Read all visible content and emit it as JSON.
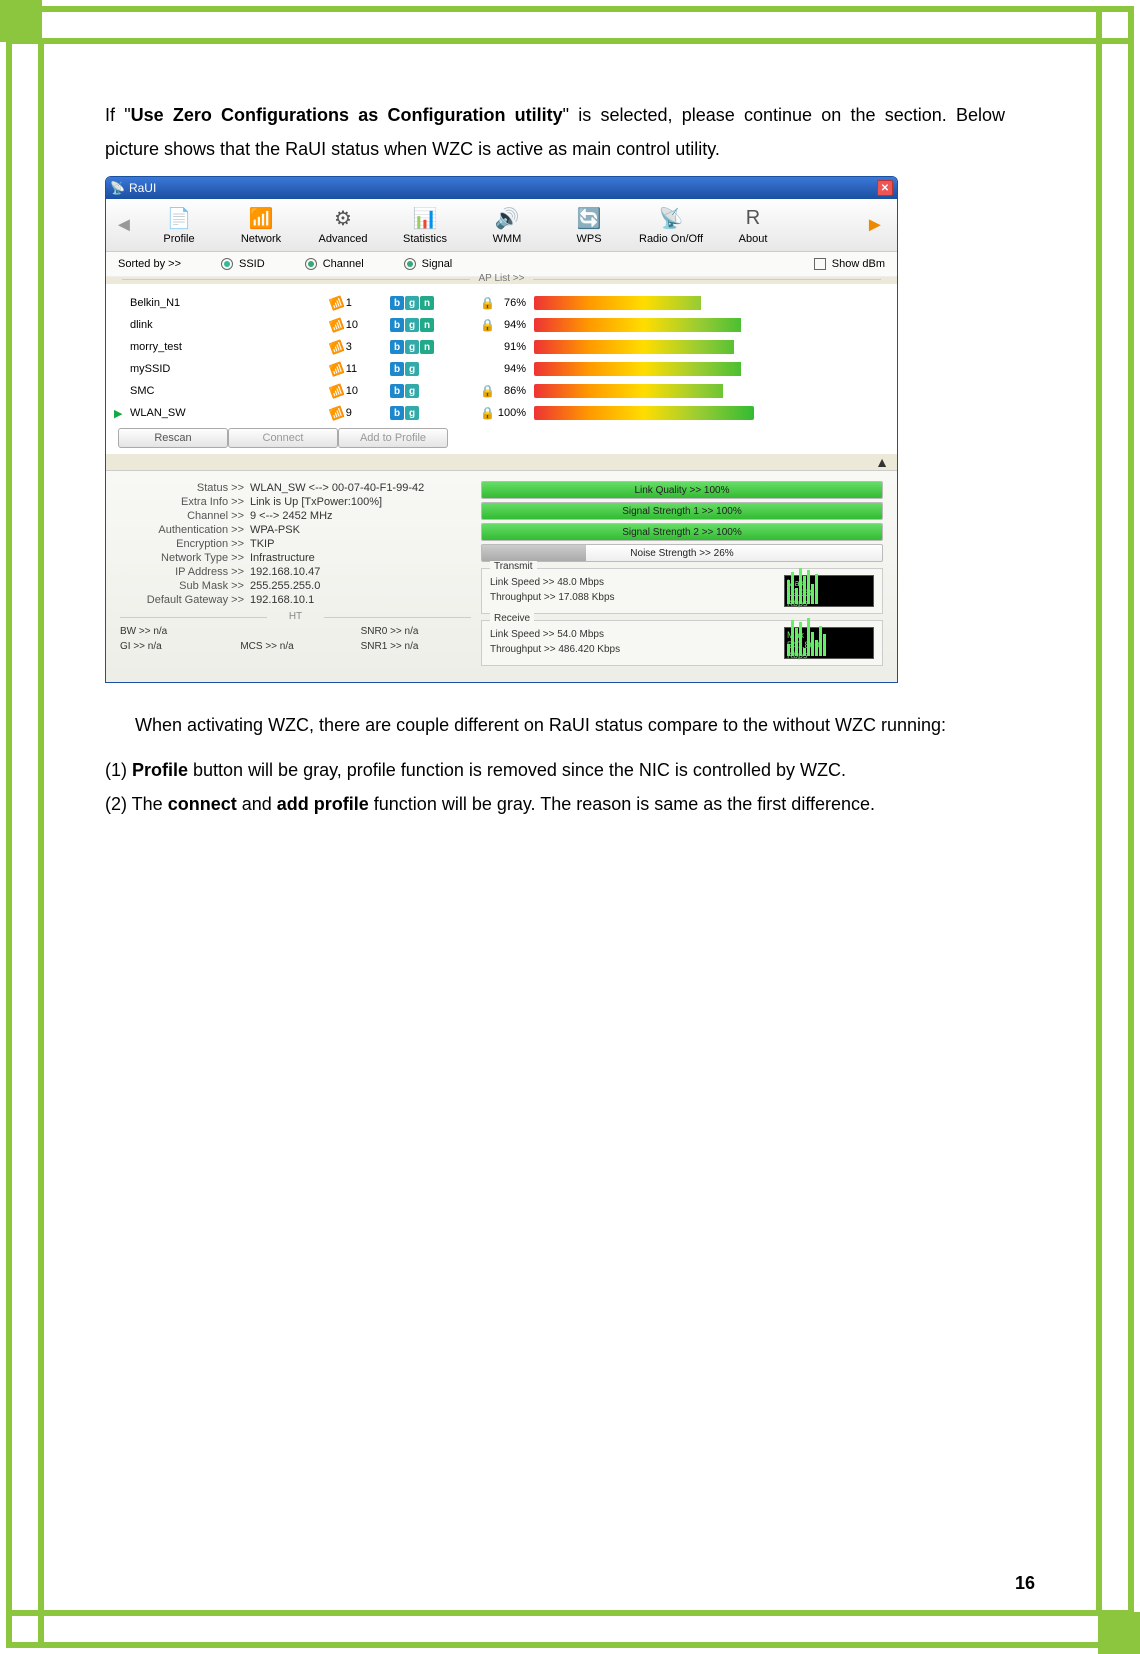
{
  "page_number": "16",
  "prose": {
    "p1a": "If \"",
    "p1b": "Use Zero Configurations as Configuration utility",
    "p1c": "\" is selected, please continue on the section. Below picture shows that the RaUI status when WZC is active as main control utility.",
    "p2": "When activating WZC, there are couple different on RaUI status compare to the without WZC running:",
    "li1a": "(1) ",
    "li1b": "Profile",
    "li1c": " button will be gray, profile function is removed since the NIC is controlled by WZC.",
    "li2a": "(2) The ",
    "li2b": "connect",
    "li2c": " and ",
    "li2d": "add profile",
    "li2e": " function will be gray. The reason is same as the first difference."
  },
  "window": {
    "title": "RaUI",
    "toolbar": {
      "items": [
        {
          "label": "Profile"
        },
        {
          "label": "Network"
        },
        {
          "label": "Advanced"
        },
        {
          "label": "Statistics"
        },
        {
          "label": "WMM"
        },
        {
          "label": "WPS"
        },
        {
          "label": "Radio On/Off"
        },
        {
          "label": "About"
        }
      ]
    },
    "sortbar": {
      "label": "Sorted by >>",
      "opt1": "SSID",
      "opt2": "Channel",
      "opt3": "Signal",
      "showdbm": "Show dBm",
      "aplist": "AP List >>"
    },
    "networks": [
      {
        "ssid": "Belkin_N1",
        "ch": "1",
        "modes": [
          "b",
          "g",
          "n"
        ],
        "lock": true,
        "pct": "76%",
        "sig": 76
      },
      {
        "ssid": "dlink",
        "ch": "10",
        "modes": [
          "b",
          "g",
          "n"
        ],
        "lock": true,
        "pct": "94%",
        "sig": 94
      },
      {
        "ssid": "morry_test",
        "ch": "3",
        "modes": [
          "b",
          "g",
          "n"
        ],
        "lock": false,
        "pct": "91%",
        "sig": 91
      },
      {
        "ssid": "mySSID",
        "ch": "11",
        "modes": [
          "b",
          "g"
        ],
        "lock": false,
        "pct": "94%",
        "sig": 94
      },
      {
        "ssid": "SMC",
        "ch": "10",
        "modes": [
          "b",
          "g"
        ],
        "lock": true,
        "pct": "86%",
        "sig": 86
      },
      {
        "ssid": "WLAN_SW",
        "ch": "9",
        "modes": [
          "b",
          "g"
        ],
        "lock": true,
        "pct": "100%",
        "sig": 100,
        "selected": true
      }
    ],
    "buttons": {
      "rescan": "Rescan",
      "connect": "Connect",
      "addprofile": "Add to Profile"
    },
    "status": {
      "rows": [
        {
          "k": "Status >>",
          "v": "WLAN_SW <--> 00-07-40-F1-99-42"
        },
        {
          "k": "Extra Info >>",
          "v": "Link is Up [TxPower:100%]"
        },
        {
          "k": "Channel >>",
          "v": "9 <--> 2452 MHz"
        },
        {
          "k": "Authentication >>",
          "v": "WPA-PSK"
        },
        {
          "k": "Encryption >>",
          "v": "TKIP"
        },
        {
          "k": "Network Type >>",
          "v": "Infrastructure"
        },
        {
          "k": "IP Address >>",
          "v": "192.168.10.47"
        },
        {
          "k": "Sub Mask >>",
          "v": "255.255.255.0"
        },
        {
          "k": "Default Gateway >>",
          "v": "192.168.10.1"
        }
      ],
      "ht_label": "HT",
      "ht": {
        "bw": "BW >> n/a",
        "snr0": "SNR0 >> n/a",
        "gi": "GI >> n/a",
        "mcs": "MCS >> n/a",
        "snr1": "SNR1 >> n/a"
      },
      "meters": {
        "lq": "Link Quality >> 100%",
        "ss1": "Signal Strength 1 >> 100%",
        "ss2": "Signal Strength 2 >> 100%",
        "ns": "Noise Strength >> 26%"
      },
      "transmit": {
        "title": "Transmit",
        "ls": "Link Speed >> 48.0 Mbps",
        "tp": "Throughput >> 17.088 Kbps",
        "max": "Max",
        "val": "19.968",
        "unit": "Kbps"
      },
      "receive": {
        "title": "Receive",
        "ls": "Link Speed >> 54.0 Mbps",
        "tp": "Throughput >> 486.420 Kbps",
        "max": "Max",
        "val": "547.860",
        "unit": "Kbps"
      }
    }
  }
}
